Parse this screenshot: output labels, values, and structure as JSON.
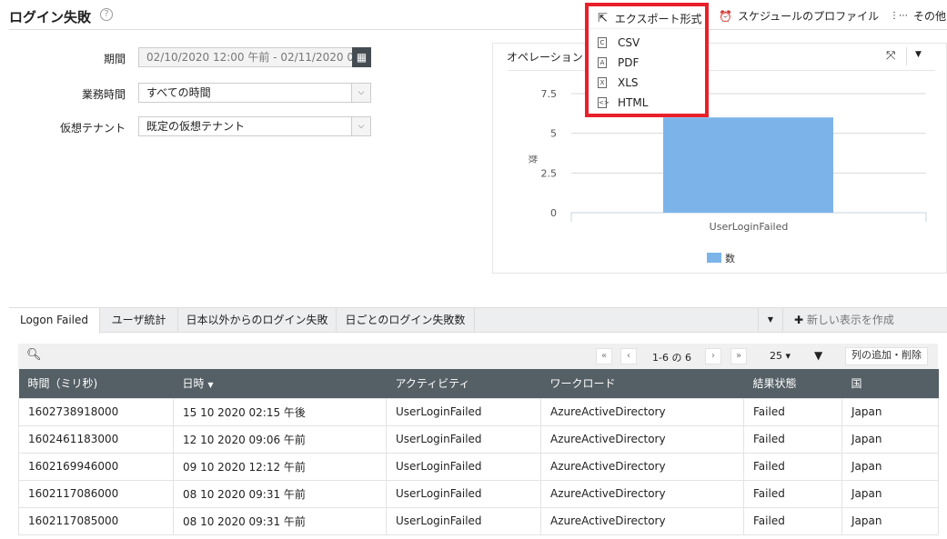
{
  "header": {
    "title": "ログイン失敗",
    "help": "?",
    "export": "エクスポート形式",
    "schedule": "スケジュールのプロファイル",
    "more": "その他"
  },
  "export_menu": {
    "items": [
      {
        "label": "CSV",
        "glyph": "C"
      },
      {
        "label": "PDF",
        "glyph": "A"
      },
      {
        "label": "XLS",
        "glyph": "X"
      },
      {
        "label": "HTML",
        "glyph": "<>"
      }
    ]
  },
  "form": {
    "period_label": "期間",
    "period_value": "02/10/2020 12:00 午前 - 02/11/2020 0",
    "business_label": "業務時間",
    "business_value": "すべての時間",
    "tenant_label": "仮想テナント",
    "tenant_value": "既定の仮想テナント"
  },
  "chart_data": {
    "type": "bar",
    "title": "オペレーション",
    "categories": [
      "UserLoginFailed"
    ],
    "values": [
      6
    ],
    "ylabel": "数",
    "ylim": [
      0,
      7.5
    ],
    "yticks": [
      "0",
      "2.5",
      "5",
      "7.5"
    ],
    "legend": "数",
    "legend_position": "bottom",
    "color": "#7cb4ea"
  },
  "tabs": {
    "items": [
      "Logon Failed",
      "ユーザ統計",
      "日本以外からのログイン失敗",
      "日ごとのログイン失敗数"
    ],
    "new_view": "新しい表示を作成"
  },
  "table": {
    "pager": "1-6 の 6",
    "page_size": "25",
    "add_remove": "列の追加・削除",
    "columns": [
      "時間（ミリ秒)",
      "日時",
      "アクティビティ",
      "ワークロード",
      "結果状態",
      "国"
    ],
    "rows": [
      [
        "1602738918000",
        "15 10 2020 02:15 午後",
        "UserLoginFailed",
        "AzureActiveDirectory",
        "Failed",
        "Japan"
      ],
      [
        "1602461183000",
        "12 10 2020 09:06 午前",
        "UserLoginFailed",
        "AzureActiveDirectory",
        "Failed",
        "Japan"
      ],
      [
        "1602169946000",
        "09 10 2020 12:12 午前",
        "UserLoginFailed",
        "AzureActiveDirectory",
        "Failed",
        "Japan"
      ],
      [
        "1602117086000",
        "08 10 2020 09:31 午前",
        "UserLoginFailed",
        "AzureActiveDirectory",
        "Failed",
        "Japan"
      ],
      [
        "1602117085000",
        "08 10 2020 09:31 午前",
        "UserLoginFailed",
        "AzureActiveDirectory",
        "Failed",
        "Japan"
      ]
    ]
  }
}
